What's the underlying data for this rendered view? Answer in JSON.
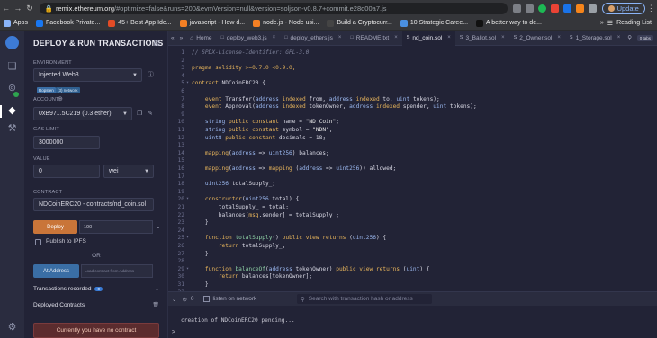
{
  "browser": {
    "url_host": "remix.ethereum.org",
    "url_rest": "/#optimize=false&runs=200&evmVersion=null&version=soljson-v0.8.7+commit.e28d00a7.js",
    "update_label": "Update",
    "bookmarks": [
      {
        "label": "Apps",
        "color": "#8ab4f8"
      },
      {
        "label": "Facebook Private...",
        "color": "#1877f2"
      },
      {
        "label": "45+ Best App Ide...",
        "color": "#e34c26"
      },
      {
        "label": "javascript - How d...",
        "color": "#f48024"
      },
      {
        "label": "node.js - Node usi...",
        "color": "#f48024"
      },
      {
        "label": "Build a Cryptocurr...",
        "color": "#444"
      },
      {
        "label": "10 Strategic Caree...",
        "color": "#4a90e2"
      },
      {
        "label": "A better way to de...",
        "color": "#111"
      }
    ],
    "reading_list": "Reading List"
  },
  "panel": {
    "title": "DEPLOY & RUN TRANSACTIONS",
    "environment_label": "ENVIRONMENT",
    "environment_value": "Injected Web3",
    "network_badge": "Ropsten",
    "network_badge2": "(3) network",
    "account_label": "ACCOUNT",
    "account_value": "0xB97...5C219 (0.3 ether)",
    "gas_label": "GAS LIMIT",
    "gas_value": "3000000",
    "value_label": "VALUE",
    "value_value": "0",
    "unit_value": "wei",
    "contract_label": "CONTRACT",
    "contract_value": "NDCoinERC20 - contracts/nd_coin.sol",
    "deploy_label": "Deploy",
    "deploy_arg": "100",
    "ipfs_label": "Publish to IPFS",
    "or_label": "OR",
    "at_address_label": "At Address",
    "at_address_placeholder": "Load contract from Address",
    "transactions_label": "Transactions recorded",
    "transactions_count": "0",
    "deployed_label": "Deployed Contracts",
    "warning": "Currently you have no contract"
  },
  "tabs": [
    {
      "label": "Home",
      "icon": "home-icon",
      "active": false
    },
    {
      "label": "deploy_web3.js",
      "active": false
    },
    {
      "label": "deploy_ethers.js",
      "active": false
    },
    {
      "label": "README.txt",
      "active": false
    },
    {
      "label": "nd_coin.sol",
      "active": true
    },
    {
      "label": "3_Ballot.sol",
      "active": false
    },
    {
      "label": "2_Owner.sol",
      "active": false
    },
    {
      "label": "1_Storage.sol",
      "active": false
    }
  ],
  "zoom_label": "0 tabs",
  "code_lines": [
    {
      "n": "1",
      "html": "<span class=\"cm\">// SPDX-License-Identifier: GPL-3.0</span>"
    },
    {
      "n": "2",
      "html": ""
    },
    {
      "n": "3",
      "html": "<span class=\"kw\">pragma solidity</span> <span class=\"kw\">&gt;=0.7.0 &lt;0.9.0;</span>"
    },
    {
      "n": "4",
      "html": ""
    },
    {
      "n": "5",
      "fold": true,
      "html": "<span class=\"kw\">contract</span> NDCoinERC20 {"
    },
    {
      "n": "6",
      "html": ""
    },
    {
      "n": "7",
      "html": "    <span class=\"kw\">event</span> Transfer(<span class=\"tp\">address</span> <span class=\"kw\">indexed</span> from, <span class=\"tp\">address</span> <span class=\"kw\">indexed</span> to, <span class=\"tp\">uint</span> tokens);"
    },
    {
      "n": "8",
      "html": "    <span class=\"kw\">event</span> Approval(<span class=\"tp\">address</span> <span class=\"kw\">indexed</span> tokenOwner, <span class=\"tp\">address</span> <span class=\"kw\">indexed</span> spender, <span class=\"tp\">uint</span> tokens);"
    },
    {
      "n": "9",
      "html": ""
    },
    {
      "n": "10",
      "html": "    <span class=\"tp\">string</span> <span class=\"kw\">public constant</span> name = <span class=\"st\">\"ND Coin\"</span>;"
    },
    {
      "n": "11",
      "html": "    <span class=\"tp\">string</span> <span class=\"kw\">public constant</span> symbol = <span class=\"st\">\"NDN\"</span>;"
    },
    {
      "n": "12",
      "html": "    <span class=\"tp\">uint8</span> <span class=\"kw\">public constant</span> decimals = 18;"
    },
    {
      "n": "13",
      "html": ""
    },
    {
      "n": "14",
      "html": "    <span class=\"kw\">mapping</span>(<span class=\"tp\">address</span> =&gt; <span class=\"tp\">uint256</span>) balances;"
    },
    {
      "n": "15",
      "html": ""
    },
    {
      "n": "16",
      "html": "    <span class=\"kw\">mapping</span>(<span class=\"tp\">address</span> =&gt; <span class=\"kw\">mapping</span> (<span class=\"tp\">address</span> =&gt; <span class=\"tp\">uint256</span>)) allowed;"
    },
    {
      "n": "17",
      "html": ""
    },
    {
      "n": "18",
      "html": "    <span class=\"tp\">uint256</span> totalSupply_;"
    },
    {
      "n": "19",
      "html": ""
    },
    {
      "n": "20",
      "fold": true,
      "html": "    <span class=\"kw\">constructor</span>(<span class=\"tp\">uint256</span> total) {"
    },
    {
      "n": "21",
      "html": "        totalSupply_ = total;"
    },
    {
      "n": "22",
      "html": "        balances[<span class=\"kw\">msg</span>.sender] = totalSupply_;"
    },
    {
      "n": "23",
      "html": "    }"
    },
    {
      "n": "24",
      "html": ""
    },
    {
      "n": "25",
      "fold": true,
      "html": "    <span class=\"kw\">function</span> <span class=\"fn\">totalSupply</span>() <span class=\"kw\">public view returns</span> (<span class=\"tp\">uint256</span>) {"
    },
    {
      "n": "26",
      "html": "        <span class=\"kw\">return</span> totalSupply_;"
    },
    {
      "n": "27",
      "html": "    }"
    },
    {
      "n": "28",
      "html": ""
    },
    {
      "n": "29",
      "fold": true,
      "html": "    <span class=\"kw\">function</span> <span class=\"fn\">balanceOf</span>(<span class=\"tp\">address</span> tokenOwner) <span class=\"kw\">public view returns</span> (<span class=\"tp\">uint</span>) {"
    },
    {
      "n": "30",
      "html": "        <span class=\"kw\">return</span> balances[tokenOwner];"
    },
    {
      "n": "31",
      "html": "    }"
    },
    {
      "n": "32",
      "html": ""
    }
  ],
  "terminal": {
    "count": "0",
    "listen_label": "listen on network",
    "search_placeholder": "Search with transaction hash or address",
    "output": "creation of NDCoinERC20 pending...",
    "prompt": ">"
  },
  "colors": {
    "accent_orange": "#c97539",
    "accent_blue": "#3a6ea5",
    "bg": "#222336"
  }
}
